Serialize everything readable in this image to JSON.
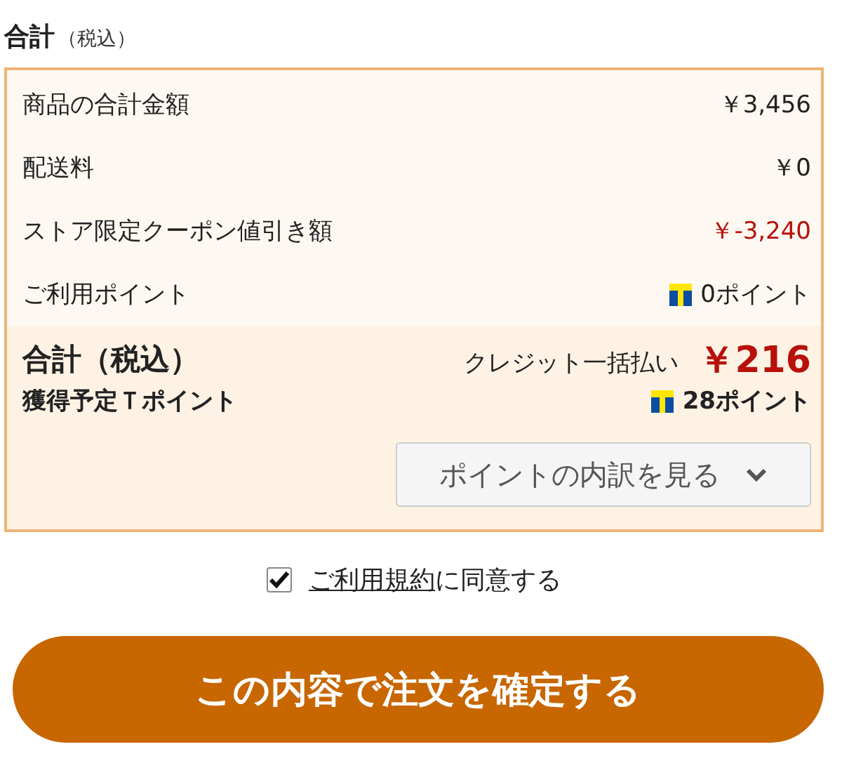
{
  "heading": {
    "title": "合計",
    "note": "（税込）"
  },
  "rows": [
    {
      "label": "商品の合計金額",
      "value": "￥3,456",
      "kind": "amount"
    },
    {
      "label": "配送料",
      "value": "￥0",
      "kind": "amount"
    },
    {
      "label": "ストア限定クーポン値引き額",
      "value": "￥-3,240",
      "kind": "discount"
    },
    {
      "label": "ご利用ポイント",
      "value": "0ポイント",
      "kind": "points"
    }
  ],
  "total": {
    "label": "合計（税込）",
    "payment": "クレジット一括払い",
    "amount": "￥216",
    "points_label": "獲得予定Ｔポイント",
    "points": "28ポイント",
    "breakdown_button": "ポイントの内訳を見る"
  },
  "agreement": {
    "checked": true,
    "link": "ご利用規約",
    "text": "に同意する"
  },
  "confirm_button": "この内容で注文を確定する"
}
